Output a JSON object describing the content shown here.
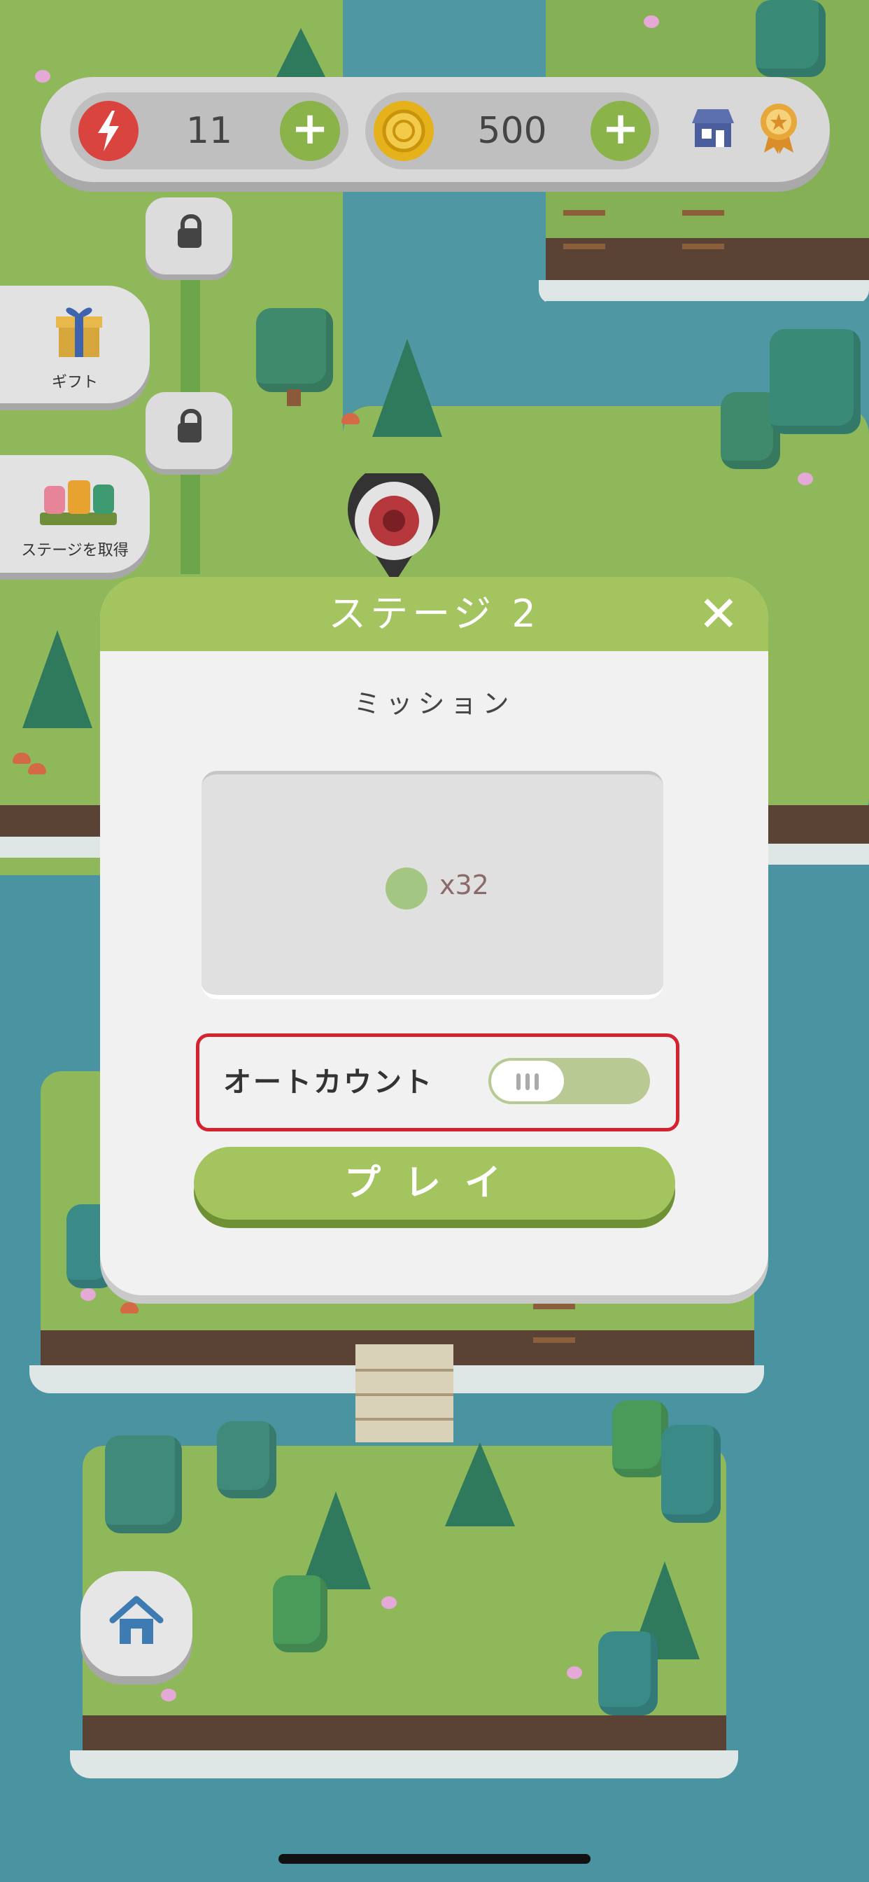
{
  "hud": {
    "energy": {
      "icon": "lightning-icon",
      "value": "11"
    },
    "coins": {
      "icon": "coin-icon",
      "value": "500"
    },
    "shop_icon": "shop-icon",
    "achievements_icon": "award-badge-icon"
  },
  "side_menu": {
    "gift": {
      "icon": "gift-icon",
      "label": "ギフト"
    },
    "get_stages": {
      "icon": "stage-houses-icon",
      "label": "ステージを取得"
    }
  },
  "map": {
    "current_marker_icon": "flower-marker-icon",
    "locked_icon": "padlock-icon"
  },
  "modal": {
    "title": "ステージ 2",
    "close_icon": "close-icon",
    "mission_label": "ミッション",
    "mission": {
      "count": "x32",
      "item_color": "#a3c783"
    },
    "auto_count_label": "オートカウント",
    "auto_count_enabled": false,
    "play_label": "プレイ"
  },
  "home": {
    "icon": "home-icon"
  },
  "colors": {
    "accent_green": "#a3c45e",
    "highlight_red": "#d4232e",
    "energy_red": "#d9443f",
    "coin_gold": "#e5b21c",
    "house_blue": "#3d7bb2"
  }
}
